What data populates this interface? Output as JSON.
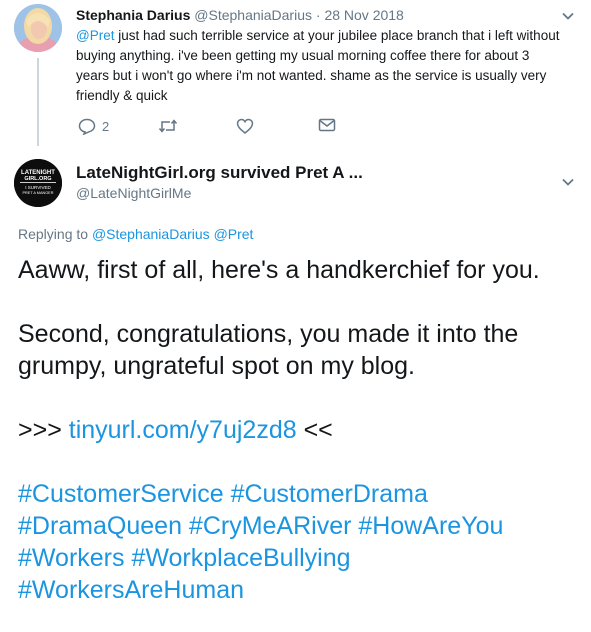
{
  "tweet1": {
    "display_name": "Stephania Darius",
    "handle": "@StephaniaDarius",
    "separator": " · ",
    "date": "28 Nov 2018",
    "mention": "@Pret",
    "text": " just had such terrible service at your jubilee place branch that i left without buying anything. i've been getting my usual morning coffee there for about 3 years but i won't go where i'm not wanted. shame as the service is usually very friendly & quick",
    "reply_count": "2",
    "icons": [
      "reply-icon",
      "retweet-icon",
      "like-icon",
      "message-icon",
      "chevron-down-icon"
    ]
  },
  "tweet2": {
    "display_name": "LateNightGirl.org survived Pret A ...",
    "handle": "@LateNightGirlMe",
    "avatar_text": {
      "line1": "LATENIGHT",
      "line2": "GIRL.ORG",
      "line3": "I SURVIVED",
      "line4": "PRET A MANGER"
    },
    "replying_prefix": "Replying to ",
    "replying_to_1": "@StephaniaDarius",
    "replying_to_2": "@Pret",
    "paragraph1": "Aaww, first of all, here's a handkerchief for you.",
    "paragraph2": "Second, congratulations, you made it into the grumpy, ungrateful spot on my blog.",
    "link_prefix": ">>> ",
    "link": "tinyurl.com/y7uj2zd8",
    "link_suffix": " <<",
    "hashtags": {
      "line1": "#CustomerService #CustomerDrama",
      "line2": "#DramaQueen #CryMeARiver #HowAreYou",
      "line3": "#Workers #WorkplaceBullying",
      "line4": "#WorkersAreHuman"
    }
  },
  "colors": {
    "link": "#1b95e0",
    "muted": "#657786",
    "text": "#14171a",
    "thread_line": "#ccd6dd"
  }
}
